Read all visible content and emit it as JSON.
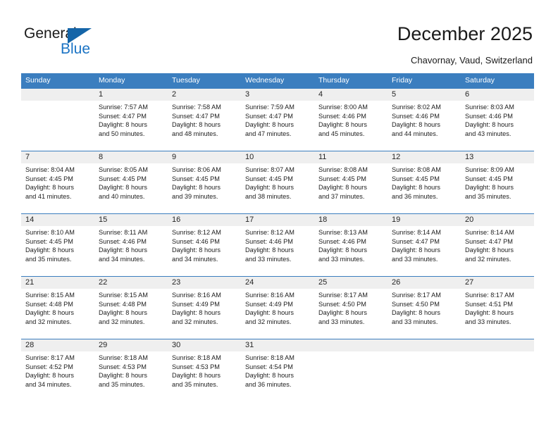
{
  "brand": {
    "name_top": "General",
    "name_bottom": "Blue",
    "accent_color": "#1a73c4",
    "triangle_color": "#1565a8",
    "logo_icon": "triangle-icon"
  },
  "header": {
    "title": "December 2025",
    "subtitle": "Chavornay, Vaud, Switzerland"
  },
  "theme": {
    "header_blue": "#3b7ebf",
    "day_number_band": "#efefef",
    "text_color": "#1d1d1d"
  },
  "weekdays": [
    "Sunday",
    "Monday",
    "Tuesday",
    "Wednesday",
    "Thursday",
    "Friday",
    "Saturday"
  ],
  "weeks": [
    [
      {
        "day": "",
        "sunrise": "",
        "sunset": "",
        "daylight_line1": "",
        "daylight_line2": ""
      },
      {
        "day": "1",
        "sunrise": "Sunrise: 7:57 AM",
        "sunset": "Sunset: 4:47 PM",
        "daylight_line1": "Daylight: 8 hours",
        "daylight_line2": "and 50 minutes."
      },
      {
        "day": "2",
        "sunrise": "Sunrise: 7:58 AM",
        "sunset": "Sunset: 4:47 PM",
        "daylight_line1": "Daylight: 8 hours",
        "daylight_line2": "and 48 minutes."
      },
      {
        "day": "3",
        "sunrise": "Sunrise: 7:59 AM",
        "sunset": "Sunset: 4:47 PM",
        "daylight_line1": "Daylight: 8 hours",
        "daylight_line2": "and 47 minutes."
      },
      {
        "day": "4",
        "sunrise": "Sunrise: 8:00 AM",
        "sunset": "Sunset: 4:46 PM",
        "daylight_line1": "Daylight: 8 hours",
        "daylight_line2": "and 45 minutes."
      },
      {
        "day": "5",
        "sunrise": "Sunrise: 8:02 AM",
        "sunset": "Sunset: 4:46 PM",
        "daylight_line1": "Daylight: 8 hours",
        "daylight_line2": "and 44 minutes."
      },
      {
        "day": "6",
        "sunrise": "Sunrise: 8:03 AM",
        "sunset": "Sunset: 4:46 PM",
        "daylight_line1": "Daylight: 8 hours",
        "daylight_line2": "and 43 minutes."
      }
    ],
    [
      {
        "day": "7",
        "sunrise": "Sunrise: 8:04 AM",
        "sunset": "Sunset: 4:45 PM",
        "daylight_line1": "Daylight: 8 hours",
        "daylight_line2": "and 41 minutes."
      },
      {
        "day": "8",
        "sunrise": "Sunrise: 8:05 AM",
        "sunset": "Sunset: 4:45 PM",
        "daylight_line1": "Daylight: 8 hours",
        "daylight_line2": "and 40 minutes."
      },
      {
        "day": "9",
        "sunrise": "Sunrise: 8:06 AM",
        "sunset": "Sunset: 4:45 PM",
        "daylight_line1": "Daylight: 8 hours",
        "daylight_line2": "and 39 minutes."
      },
      {
        "day": "10",
        "sunrise": "Sunrise: 8:07 AM",
        "sunset": "Sunset: 4:45 PM",
        "daylight_line1": "Daylight: 8 hours",
        "daylight_line2": "and 38 minutes."
      },
      {
        "day": "11",
        "sunrise": "Sunrise: 8:08 AM",
        "sunset": "Sunset: 4:45 PM",
        "daylight_line1": "Daylight: 8 hours",
        "daylight_line2": "and 37 minutes."
      },
      {
        "day": "12",
        "sunrise": "Sunrise: 8:08 AM",
        "sunset": "Sunset: 4:45 PM",
        "daylight_line1": "Daylight: 8 hours",
        "daylight_line2": "and 36 minutes."
      },
      {
        "day": "13",
        "sunrise": "Sunrise: 8:09 AM",
        "sunset": "Sunset: 4:45 PM",
        "daylight_line1": "Daylight: 8 hours",
        "daylight_line2": "and 35 minutes."
      }
    ],
    [
      {
        "day": "14",
        "sunrise": "Sunrise: 8:10 AM",
        "sunset": "Sunset: 4:45 PM",
        "daylight_line1": "Daylight: 8 hours",
        "daylight_line2": "and 35 minutes."
      },
      {
        "day": "15",
        "sunrise": "Sunrise: 8:11 AM",
        "sunset": "Sunset: 4:46 PM",
        "daylight_line1": "Daylight: 8 hours",
        "daylight_line2": "and 34 minutes."
      },
      {
        "day": "16",
        "sunrise": "Sunrise: 8:12 AM",
        "sunset": "Sunset: 4:46 PM",
        "daylight_line1": "Daylight: 8 hours",
        "daylight_line2": "and 34 minutes."
      },
      {
        "day": "17",
        "sunrise": "Sunrise: 8:12 AM",
        "sunset": "Sunset: 4:46 PM",
        "daylight_line1": "Daylight: 8 hours",
        "daylight_line2": "and 33 minutes."
      },
      {
        "day": "18",
        "sunrise": "Sunrise: 8:13 AM",
        "sunset": "Sunset: 4:46 PM",
        "daylight_line1": "Daylight: 8 hours",
        "daylight_line2": "and 33 minutes."
      },
      {
        "day": "19",
        "sunrise": "Sunrise: 8:14 AM",
        "sunset": "Sunset: 4:47 PM",
        "daylight_line1": "Daylight: 8 hours",
        "daylight_line2": "and 33 minutes."
      },
      {
        "day": "20",
        "sunrise": "Sunrise: 8:14 AM",
        "sunset": "Sunset: 4:47 PM",
        "daylight_line1": "Daylight: 8 hours",
        "daylight_line2": "and 32 minutes."
      }
    ],
    [
      {
        "day": "21",
        "sunrise": "Sunrise: 8:15 AM",
        "sunset": "Sunset: 4:48 PM",
        "daylight_line1": "Daylight: 8 hours",
        "daylight_line2": "and 32 minutes."
      },
      {
        "day": "22",
        "sunrise": "Sunrise: 8:15 AM",
        "sunset": "Sunset: 4:48 PM",
        "daylight_line1": "Daylight: 8 hours",
        "daylight_line2": "and 32 minutes."
      },
      {
        "day": "23",
        "sunrise": "Sunrise: 8:16 AM",
        "sunset": "Sunset: 4:49 PM",
        "daylight_line1": "Daylight: 8 hours",
        "daylight_line2": "and 32 minutes."
      },
      {
        "day": "24",
        "sunrise": "Sunrise: 8:16 AM",
        "sunset": "Sunset: 4:49 PM",
        "daylight_line1": "Daylight: 8 hours",
        "daylight_line2": "and 32 minutes."
      },
      {
        "day": "25",
        "sunrise": "Sunrise: 8:17 AM",
        "sunset": "Sunset: 4:50 PM",
        "daylight_line1": "Daylight: 8 hours",
        "daylight_line2": "and 33 minutes."
      },
      {
        "day": "26",
        "sunrise": "Sunrise: 8:17 AM",
        "sunset": "Sunset: 4:50 PM",
        "daylight_line1": "Daylight: 8 hours",
        "daylight_line2": "and 33 minutes."
      },
      {
        "day": "27",
        "sunrise": "Sunrise: 8:17 AM",
        "sunset": "Sunset: 4:51 PM",
        "daylight_line1": "Daylight: 8 hours",
        "daylight_line2": "and 33 minutes."
      }
    ],
    [
      {
        "day": "28",
        "sunrise": "Sunrise: 8:17 AM",
        "sunset": "Sunset: 4:52 PM",
        "daylight_line1": "Daylight: 8 hours",
        "daylight_line2": "and 34 minutes."
      },
      {
        "day": "29",
        "sunrise": "Sunrise: 8:18 AM",
        "sunset": "Sunset: 4:53 PM",
        "daylight_line1": "Daylight: 8 hours",
        "daylight_line2": "and 35 minutes."
      },
      {
        "day": "30",
        "sunrise": "Sunrise: 8:18 AM",
        "sunset": "Sunset: 4:53 PM",
        "daylight_line1": "Daylight: 8 hours",
        "daylight_line2": "and 35 minutes."
      },
      {
        "day": "31",
        "sunrise": "Sunrise: 8:18 AM",
        "sunset": "Sunset: 4:54 PM",
        "daylight_line1": "Daylight: 8 hours",
        "daylight_line2": "and 36 minutes."
      },
      {
        "day": "",
        "sunrise": "",
        "sunset": "",
        "daylight_line1": "",
        "daylight_line2": ""
      },
      {
        "day": "",
        "sunrise": "",
        "sunset": "",
        "daylight_line1": "",
        "daylight_line2": ""
      },
      {
        "day": "",
        "sunrise": "",
        "sunset": "",
        "daylight_line1": "",
        "daylight_line2": ""
      }
    ]
  ]
}
